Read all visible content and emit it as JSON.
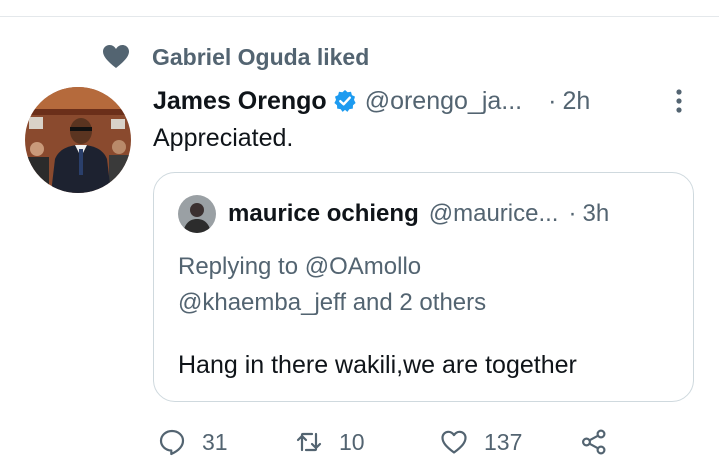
{
  "social_context": {
    "icon": "heart-icon",
    "text": "Gabriel Oguda liked"
  },
  "tweet": {
    "author_name": "James Orengo",
    "verified": true,
    "handle": "@orengo_ja...",
    "separator": "·",
    "time": "2h",
    "text": "Appreciated."
  },
  "quote": {
    "author_name": "maurice ochieng",
    "handle": "@maurice...",
    "separator": "·",
    "time": "3h",
    "reply_prefix": "Replying to ",
    "reply_user": "@OAmollo",
    "reply_line2_user": "@khaemba_jeff",
    "reply_line2_rest": " and 2 others",
    "text": "Hang in there wakili,we are together"
  },
  "actions": {
    "replies": "31",
    "retweets": "10",
    "likes": "137"
  },
  "colors": {
    "text": "#0f1419",
    "secondary": "#536471",
    "verified": "#1d9bf0",
    "border": "#cfd9de"
  }
}
